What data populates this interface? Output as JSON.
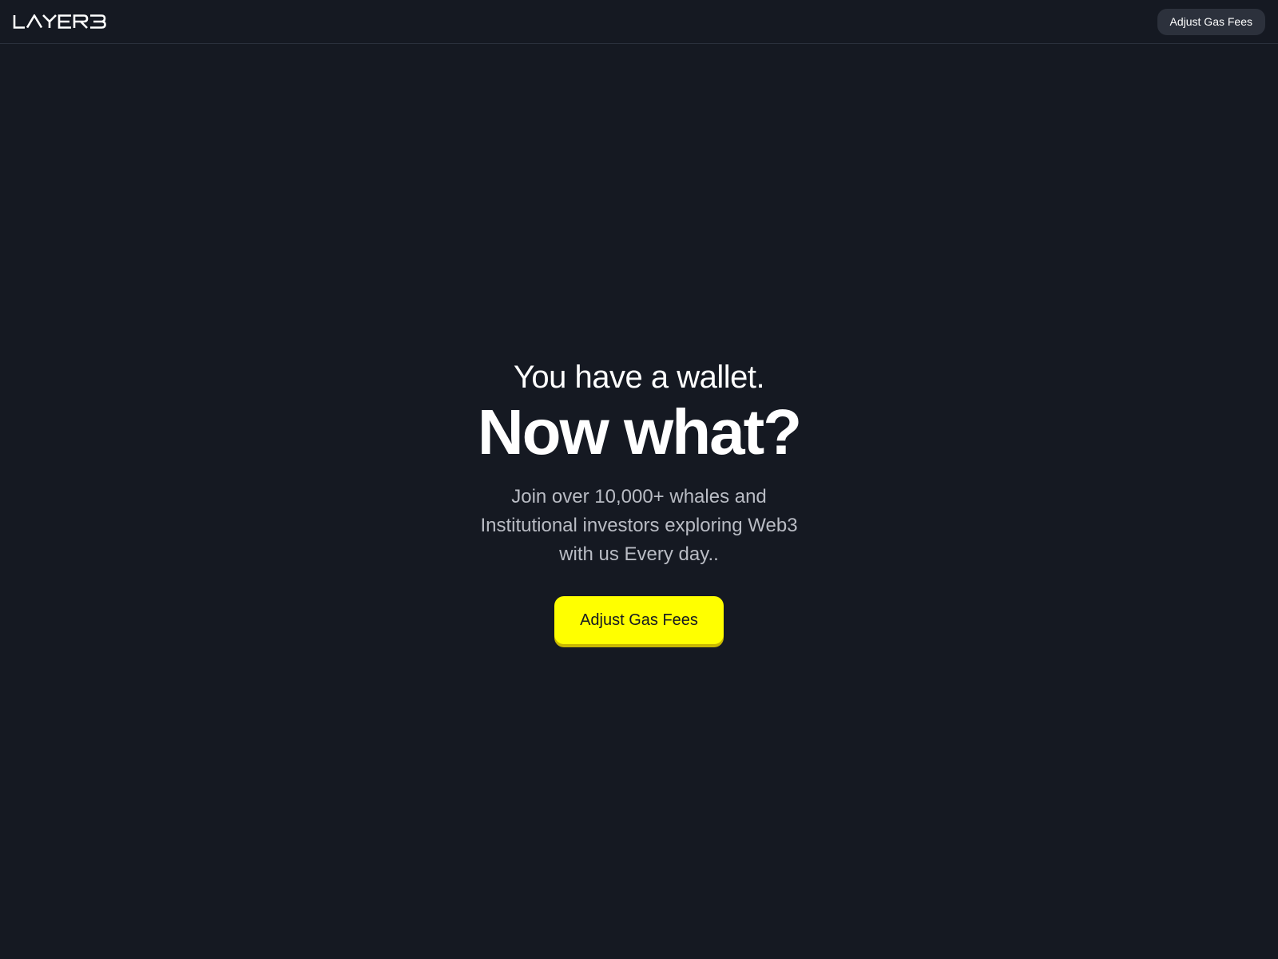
{
  "header": {
    "logo_text": "LAYER3",
    "button_label": "Adjust Gas Fees"
  },
  "hero": {
    "lead": "You have a wallet.",
    "title": "Now what?",
    "subtitle": "Join over 10,000+ whales and Institutional investors exploring Web3 with us Every day..",
    "cta_label": "Adjust Gas Fees"
  },
  "colors": {
    "background": "#151922",
    "accent": "#ffff00",
    "header_button_bg": "#2c313c",
    "subtitle_text": "#b9bcc4"
  }
}
